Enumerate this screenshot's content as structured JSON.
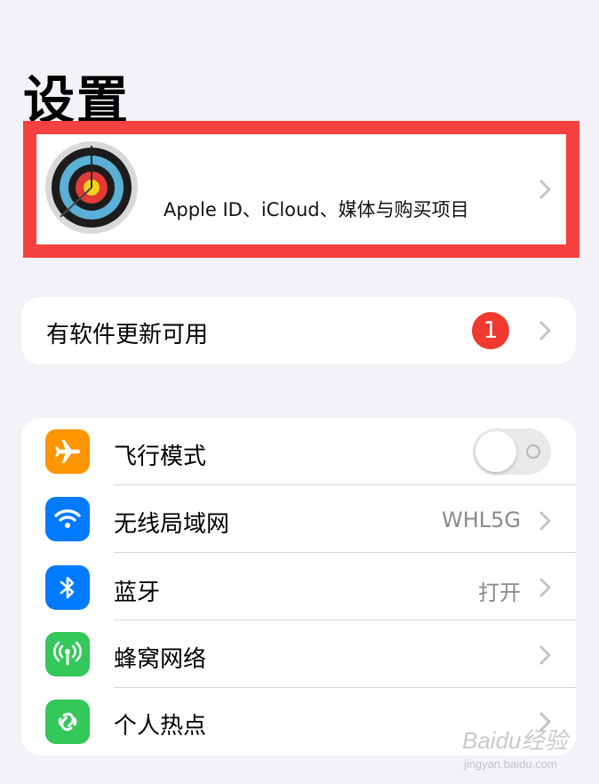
{
  "page": {
    "title": "设置"
  },
  "apple_id": {
    "name": "",
    "subtitle": "Apple ID、iCloud、媒体与购买项目"
  },
  "update": {
    "label": "有软件更新可用",
    "badge": "1"
  },
  "settings": [
    {
      "label": "飞行模式",
      "icon": "airplane-icon",
      "color": "#ff9500",
      "value": "",
      "toggle": false
    },
    {
      "label": "无线局域网",
      "icon": "wifi-icon",
      "color": "#007aff",
      "value": "WHL5G"
    },
    {
      "label": "蓝牙",
      "icon": "bluetooth-icon",
      "color": "#007aff",
      "value": "打开"
    },
    {
      "label": "蜂窝网络",
      "icon": "cellular-icon",
      "color": "#34c759",
      "value": ""
    },
    {
      "label": "个人热点",
      "icon": "hotspot-icon",
      "color": "#34c759",
      "value": ""
    }
  ],
  "colors": {
    "background": "#f2f2f7",
    "highlight": "#f5413f",
    "badge": "#f03a2f"
  },
  "watermark": {
    "text": "Baidu经验",
    "sub": "jingyan.baidu.com"
  }
}
